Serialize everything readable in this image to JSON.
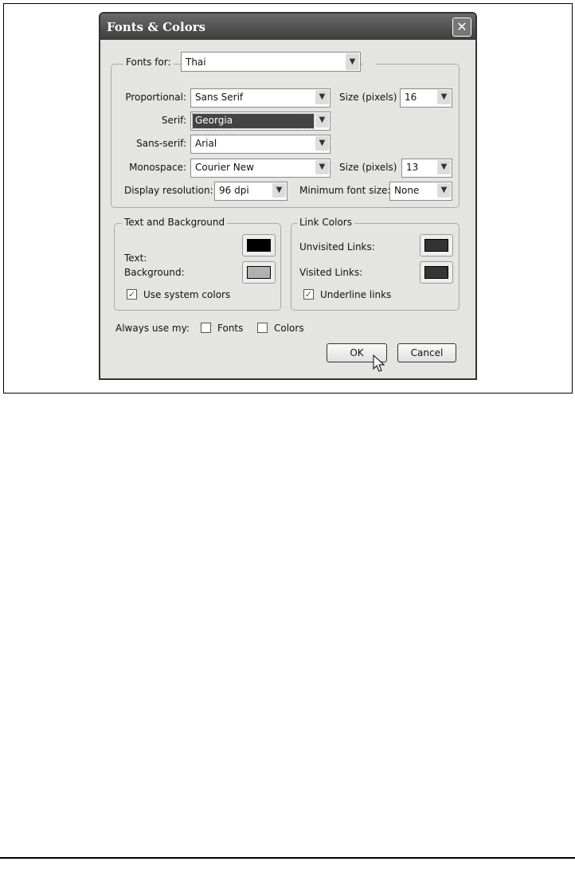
{
  "dialog": {
    "title": "Fonts & Colors",
    "close_icon": "close-icon"
  },
  "fonts_group": {
    "legend": "Fonts for:",
    "fonts_for": "Thai",
    "proportional_label": "Proportional:",
    "proportional": "Sans Serif",
    "size_label": "Size (pixels)",
    "proportional_size": "16",
    "serif_label": "Serif:",
    "serif": "Georgia",
    "sans_serif_label": "Sans-serif:",
    "sans_serif": "Arial",
    "monospace_label": "Monospace:",
    "monospace": "Courier New",
    "monospace_size": "13",
    "resolution_label": "Display resolution:",
    "resolution": "96 dpi",
    "min_size_label": "Minimum font size:",
    "min_size": "None"
  },
  "text_bg": {
    "legend": "Text and Background",
    "text_label": "Text:",
    "text_color": "#000000",
    "bg_label": "Background:",
    "bg_color": "#b0b0b0",
    "system_colors_label": "Use system colors",
    "system_colors_checked": true
  },
  "links": {
    "legend": "Link Colors",
    "unvisited_label": "Unvisited Links:",
    "unvisited_color": "#333333",
    "visited_label": "Visited Links:",
    "visited_color": "#353535",
    "underline_label": "Underline links",
    "underline_checked": true
  },
  "always": {
    "label": "Always use my:",
    "fonts_label": "Fonts",
    "fonts_checked": false,
    "colors_label": "Colors",
    "colors_checked": false
  },
  "buttons": {
    "ok": "OK",
    "cancel": "Cancel"
  }
}
